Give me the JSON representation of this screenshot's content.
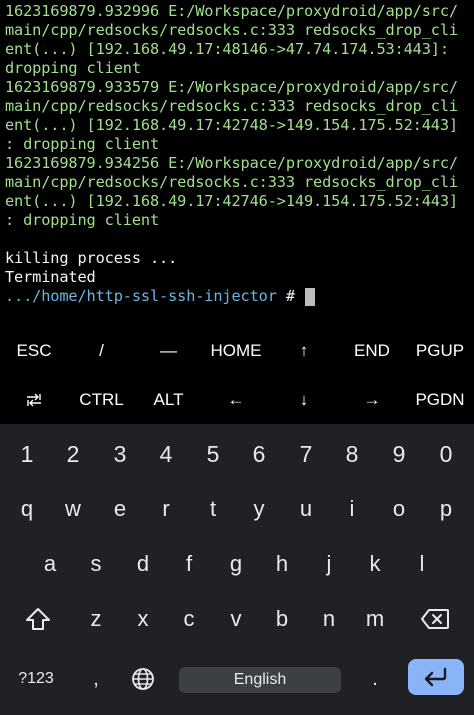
{
  "terminal": {
    "lines": [
      {
        "text": "1623169879.932996 E:/Workspace/proxydroid/app/src/",
        "color": "green"
      },
      {
        "text": "main/cpp/redsocks/redsocks.c:333 redsocks_drop_cli",
        "color": "green"
      },
      {
        "text": "ent(...) [192.168.49.17:48146->47.74.174.53:443]:",
        "color": "green"
      },
      {
        "text": "dropping client",
        "color": "green"
      },
      {
        "text": "1623169879.933579 E:/Workspace/proxydroid/app/src/",
        "color": "green"
      },
      {
        "text": "main/cpp/redsocks/redsocks.c:333 redsocks_drop_cli",
        "color": "green"
      },
      {
        "text": "ent(...) [192.168.49.17:42748->149.154.175.52:443]",
        "color": "green"
      },
      {
        "text": ": dropping client",
        "color": "green"
      },
      {
        "text": "1623169879.934256 E:/Workspace/proxydroid/app/src/",
        "color": "green"
      },
      {
        "text": "main/cpp/redsocks/redsocks.c:333 redsocks_drop_cli",
        "color": "green"
      },
      {
        "text": "ent(...) [192.168.49.17:42746->149.154.175.52:443]",
        "color": "green"
      },
      {
        "text": ": dropping client",
        "color": "green"
      },
      {
        "text": "",
        "color": "white"
      },
      {
        "text": "killing process ...",
        "color": "white"
      },
      {
        "text": "Terminated",
        "color": "white"
      }
    ],
    "prompt_path": ".../home/http-ssl-ssh-injector",
    "prompt_symbol": " # "
  },
  "extra_keys": {
    "row1": [
      "ESC",
      "/",
      "―",
      "HOME",
      "↑",
      "END",
      "PGUP"
    ],
    "row2": [
      "⭾",
      "CTRL",
      "ALT",
      "←",
      "↓",
      "→",
      "PGDN"
    ],
    "tab_icon": "tab-arrows-icon"
  },
  "keyboard": {
    "numbers": [
      "1",
      "2",
      "3",
      "4",
      "5",
      "6",
      "7",
      "8",
      "9",
      "0"
    ],
    "row_q": [
      "q",
      "w",
      "e",
      "r",
      "t",
      "y",
      "u",
      "i",
      "o",
      "p"
    ],
    "row_a": [
      "a",
      "s",
      "d",
      "f",
      "g",
      "h",
      "j",
      "k",
      "l"
    ],
    "row_z": [
      "z",
      "x",
      "c",
      "v",
      "b",
      "n",
      "m"
    ],
    "symbols_label": "?123",
    "comma": ",",
    "space_label": "English",
    "period": ".",
    "icons": {
      "shift": "shift-arrow-icon",
      "backspace": "backspace-icon",
      "language": "globe-icon",
      "enter": "enter-arrow-icon"
    },
    "colors": {
      "background": "#202124",
      "space_bar": "#3c4043",
      "enter_key": "#8ab4f8",
      "key_text": "#e8eaed"
    }
  },
  "colors": {
    "terminal_green": "#9fe08c",
    "terminal_white": "#f4f4f4",
    "prompt_blue": "#69b7e0"
  }
}
